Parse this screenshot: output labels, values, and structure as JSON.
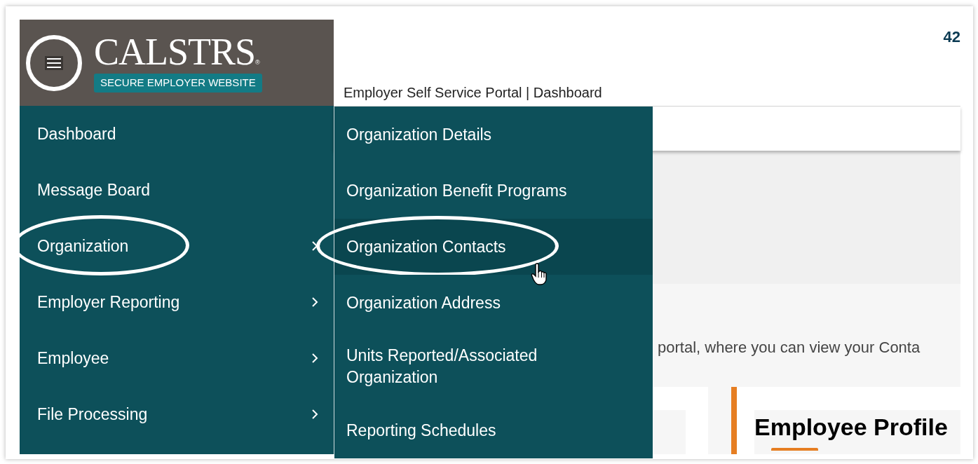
{
  "header": {
    "menu_button": {
      "circled": true
    },
    "logo": {
      "name": "CALSTRS",
      "mark": "®",
      "tagline": "SECURE EMPLOYER WEBSITE"
    },
    "top_right_text": "42",
    "page_title": "Employer Self Service Portal | Dashboard"
  },
  "menu": {
    "items": [
      {
        "label": "Dashboard",
        "has_submenu": false,
        "circled": false
      },
      {
        "label": "Message Board",
        "has_submenu": false,
        "circled": false
      },
      {
        "label": "Organization",
        "has_submenu": true,
        "circled": true
      },
      {
        "label": "Employer Reporting",
        "has_submenu": true,
        "circled": false
      },
      {
        "label": "Employee",
        "has_submenu": true,
        "circled": false
      },
      {
        "label": "File Processing",
        "has_submenu": true,
        "circled": false
      }
    ]
  },
  "submenu": {
    "items": [
      {
        "label": "Organization Details",
        "selected": false,
        "circled": false
      },
      {
        "label": "Organization Benefit Programs",
        "selected": false,
        "circled": false
      },
      {
        "label": "Organization Contacts",
        "selected": true,
        "circled": true
      },
      {
        "label": "Organization Address",
        "selected": false,
        "circled": false
      },
      {
        "label": "Units Reported/Associated Organization",
        "selected": false,
        "circled": false
      },
      {
        "label": "Reporting Schedules",
        "selected": false,
        "circled": false
      }
    ]
  },
  "content": {
    "intro_text": "portal, where you can view your Conta",
    "card_title": "Employee Profile"
  }
}
